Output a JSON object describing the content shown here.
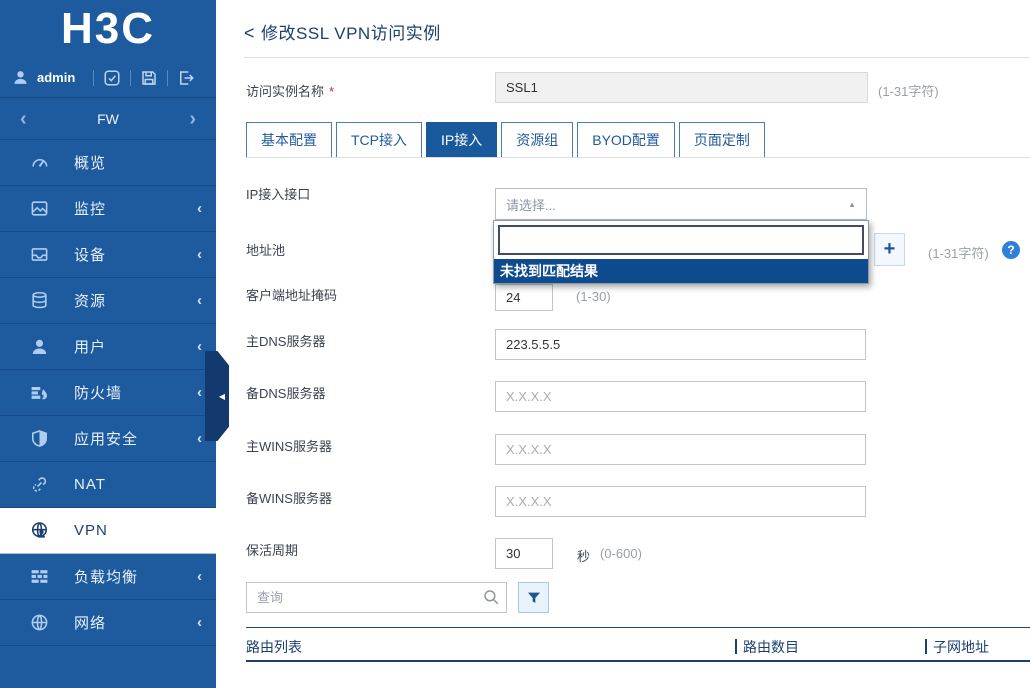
{
  "colors": {
    "sidebar_blue": "#1e5a9e",
    "active_tab_blue": "#195a9c",
    "dropdown_highlight_navy": "#0d4a8e",
    "title_navy": "#1c3f6e",
    "help_blue": "#2f80d6",
    "required_red": "#e02020"
  },
  "sidebar": {
    "logo_text": "H3C",
    "user": {
      "name": "admin",
      "action_icons": [
        "task-check-icon",
        "save-icon",
        "logout-icon"
      ]
    },
    "device": {
      "prev": "‹",
      "label": "FW",
      "next": "›"
    },
    "collapse_arrow": "◀",
    "menu": [
      {
        "label": "概览",
        "icon": "gauge-icon",
        "chevron": ""
      },
      {
        "label": "监控",
        "icon": "monitor-icon",
        "chevron": "‹"
      },
      {
        "label": "设备",
        "icon": "device-icon",
        "chevron": "‹"
      },
      {
        "label": "资源",
        "icon": "database-icon",
        "chevron": "‹"
      },
      {
        "label": "用户",
        "icon": "user-icon",
        "chevron": "‹"
      },
      {
        "label": "防火墙",
        "icon": "firewall-icon",
        "chevron": "‹"
      },
      {
        "label": "应用安全",
        "icon": "shield-icon",
        "chevron": "‹"
      },
      {
        "label": "NAT",
        "icon": "nat-link-icon",
        "chevron": ""
      },
      {
        "label": "VPN",
        "icon": "vpn-globe-icon",
        "chevron": "",
        "active": true
      },
      {
        "label": "负载均衡",
        "icon": "load-balancer-icon",
        "chevron": "‹"
      },
      {
        "label": "网络",
        "icon": "network-globe-icon",
        "chevron": "‹"
      }
    ]
  },
  "page": {
    "back_arrow": "<",
    "title": "修改SSL VPN访问实例"
  },
  "form": {
    "instance_name": {
      "label": "访问实例名称",
      "required_mark": "*",
      "value": "SSL1",
      "hint": "(1-31字符)"
    },
    "tabs": [
      {
        "label": "基本配置"
      },
      {
        "label": "TCP接入"
      },
      {
        "label": "IP接入",
        "active": true
      },
      {
        "label": "资源组"
      },
      {
        "label": "BYOD配置"
      },
      {
        "label": "页面定制"
      }
    ],
    "ip_interface": {
      "label": "IP接入接口",
      "selected_text": "请选择...",
      "arrow": "▲",
      "dropdown": {
        "search_value": "",
        "no_match_text": "未找到匹配结果"
      }
    },
    "address_pool": {
      "label": "地址池",
      "add_button": "+",
      "hint": "(1-31字符)",
      "help": "?"
    },
    "client_mask": {
      "label": "客户端地址掩码",
      "value": "24",
      "hint": "(1-30)"
    },
    "dns_primary": {
      "label": "主DNS服务器",
      "value": "223.5.5.5"
    },
    "dns_secondary": {
      "label": "备DNS服务器",
      "placeholder": "X.X.X.X"
    },
    "wins_primary": {
      "label": "主WINS服务器",
      "placeholder": "X.X.X.X"
    },
    "wins_secondary": {
      "label": "备WINS服务器",
      "placeholder": "X.X.X.X"
    },
    "keepalive": {
      "label": "保活周期",
      "value": "30",
      "unit": "秒",
      "hint": "(0-600)"
    }
  },
  "route_table": {
    "search_placeholder": "查询",
    "columns": [
      "路由列表",
      "路由数目",
      "子网地址"
    ],
    "rows": []
  }
}
